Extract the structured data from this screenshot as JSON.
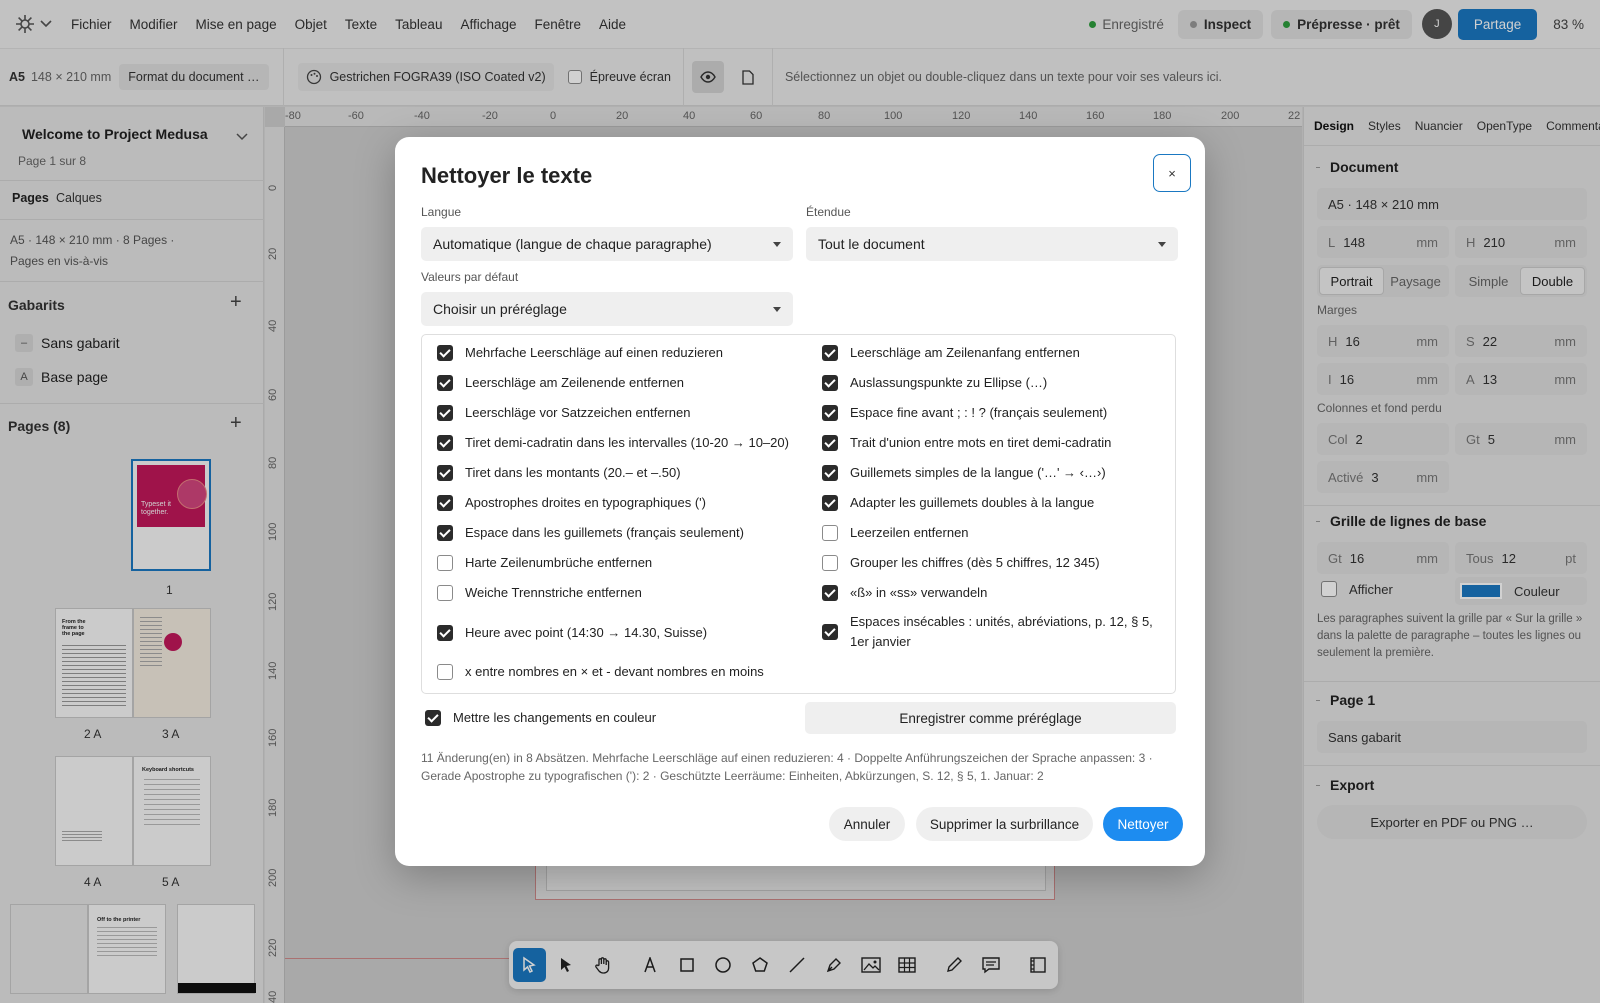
{
  "menubar": {
    "items": [
      "Fichier",
      "Modifier",
      "Mise en page",
      "Objet",
      "Texte",
      "Tableau",
      "Affichage",
      "Fenêtre",
      "Aide"
    ],
    "saved_status": "Enregistré",
    "inspect_label": "Inspect",
    "prepress_label": "Prépresse · prêt",
    "avatar_initial": "J",
    "share_label": "Partage",
    "zoom": "83 %"
  },
  "toolbar": {
    "format_badge": "A5",
    "format_size": "148 × 210 mm",
    "doc_format_button": "Format du document …",
    "color_profile": "Gestrichen FOGRA39 (ISO Coated v2)",
    "proof_label": "Épreuve écran",
    "hint": "Sélectionnez un objet ou double-cliquez dans un texte pour voir ses valeurs ici."
  },
  "left": {
    "project_title": "Welcome to Project Medusa",
    "page_info": "Page 1 sur 8",
    "tabs": [
      "Pages",
      "Calques"
    ],
    "doc_info_1": "A5 · 148 × 210 mm · 8 Pages ·",
    "doc_info_2": "Pages en vis-à-vis",
    "masters_title": "Gabarits",
    "masters": [
      {
        "badge": "–",
        "label": "Sans gabarit"
      },
      {
        "badge": "A",
        "label": "Base page"
      }
    ],
    "pages_title": "Pages (8)",
    "page_labels": [
      "1",
      "2 A",
      "3 A",
      "4 A",
      "5 A"
    ],
    "thumb1_text": "Typeset it together.",
    "thumb2_text": "From the frame to the page",
    "thumb5_text": "Keyboard shortcuts",
    "thumb7_text": "Off to the printer"
  },
  "ruler": {
    "top": [
      "-80",
      "-60",
      "-40",
      "-20",
      "0",
      "20",
      "40",
      "60",
      "80",
      "100",
      "120",
      "140",
      "160",
      "180",
      "200",
      "22"
    ],
    "left": [
      "0",
      "20",
      "40",
      "60",
      "80",
      "100",
      "120",
      "140",
      "160",
      "180",
      "200",
      "220",
      "40"
    ]
  },
  "dialog": {
    "title": "Nettoyer le texte",
    "close_label": "×",
    "language_label": "Langue",
    "language_value": "Automatique (langue de chaque paragraphe)",
    "scope_label": "Étendue",
    "scope_value": "Tout le document",
    "defaults_label": "Valeurs par défaut",
    "defaults_value": "Choisir un préréglage",
    "options_left": [
      {
        "label": "Mehrfache Leerschläge auf einen reduzieren",
        "checked": true
      },
      {
        "label": "Leerschläge am Zeilenende entfernen",
        "checked": true
      },
      {
        "label": "Leerschläge vor Satzzeichen entfernen",
        "checked": true
      },
      {
        "label": "Tiret demi-cadratin dans les intervalles (10-20 → 10–20)",
        "checked": true
      },
      {
        "label": "Tiret dans les montants (20.– et –.50)",
        "checked": true
      },
      {
        "label": "Apostrophes droites en typographiques (')",
        "checked": true
      },
      {
        "label": "Espace dans les guillemets (français seulement)",
        "checked": true
      },
      {
        "label": "Harte Zeilenumbrüche entfernen",
        "checked": false
      },
      {
        "label": "Weiche Trennstriche entfernen",
        "checked": false
      },
      {
        "label": "Heure avec point (14:30 → 14.30, Suisse)",
        "checked": true
      },
      {
        "label": "x entre nombres en × et - devant nombres en moins",
        "checked": false
      }
    ],
    "options_right": [
      {
        "label": "Leerschläge am Zeilenanfang entfernen",
        "checked": true
      },
      {
        "label": "Auslassungspunkte zu Ellipse (…)",
        "checked": true
      },
      {
        "label": "Espace fine avant ; : ! ? (français seulement)",
        "checked": true
      },
      {
        "label": "Trait d'union entre mots en tiret demi-cadratin",
        "checked": true
      },
      {
        "label": "Guillemets simples de la langue ('…' → ‹…›)",
        "checked": true
      },
      {
        "label": "Adapter les guillemets doubles à la langue",
        "checked": true
      },
      {
        "label": "Leerzeilen entfernen",
        "checked": false
      },
      {
        "label": "Grouper les chiffres (dès 5 chiffres, 12 345)",
        "checked": false
      },
      {
        "label": "«ß» in «ss» verwandeln",
        "checked": true
      },
      {
        "label": "Espaces insécables : unités, abréviations, p. 12, § 5, 1er janvier",
        "checked": true
      }
    ],
    "highlight_label": "Mettre les changements en couleur",
    "highlight_checked": true,
    "save_preset_label": "Enregistrer comme préréglage",
    "summary": "11 Änderung(en) in 8 Absätzen. Mehrfache Leerschläge auf einen reduzieren: 4 · Doppelte Anführungszeichen der Sprache anpassen: 3 · Gerade Apostrophe zu typografischen ('): 2 · Geschützte Leerräume: Einheiten, Abkürzungen, S. 12, § 5, 1. Januar: 2",
    "cancel_label": "Annuler",
    "remove_highlight_label": "Supprimer la surbrillance",
    "clean_label": "Nettoyer"
  },
  "right": {
    "tabs": [
      "Design",
      "Styles",
      "Nuancier",
      "OpenType",
      "Commentai"
    ],
    "document_title": "Document",
    "format_value": "A5 · 148 × 210 mm",
    "width": {
      "key": "L",
      "value": "148",
      "unit": "mm"
    },
    "height": {
      "key": "H",
      "value": "210",
      "unit": "mm"
    },
    "orientation": [
      "Portrait",
      "Paysage"
    ],
    "pages_mode": [
      "Simple",
      "Double"
    ],
    "margins_title": "Marges",
    "margin_top": {
      "key": "H",
      "value": "16",
      "unit": "mm"
    },
    "margin_right": {
      "key": "S",
      "value": "22",
      "unit": "mm"
    },
    "margin_inner": {
      "key": "I",
      "value": "16",
      "unit": "mm"
    },
    "margin_outer": {
      "key": "A",
      "value": "13",
      "unit": "mm"
    },
    "columns_title": "Colonnes et fond perdu",
    "columns": {
      "key": "Col",
      "value": "2"
    },
    "gutter": {
      "key": "Gt",
      "value": "5",
      "unit": "mm"
    },
    "bleed": {
      "key": "Activé",
      "value": "3",
      "unit": "mm"
    },
    "baseline_title": "Grille de lignes de base",
    "baseline_gt": {
      "key": "Gt",
      "value": "16",
      "unit": "mm"
    },
    "baseline_all": {
      "key": "Tous",
      "value": "12",
      "unit": "pt"
    },
    "show_label": "Afficher",
    "color_label": "Couleur",
    "baseline_color": "#1a78c2",
    "baseline_note": "Les paragraphes suivent la grille par « Sur la grille » dans la palette de paragraphe – toutes les lignes ou seulement la première.",
    "page_title": "Page 1",
    "page_master": "Sans gabarit",
    "export_title": "Export",
    "export_button": "Exporter en PDF ou PNG …"
  },
  "colors": {
    "accent": "#1a78c2",
    "primary_button": "#1d8cf0",
    "saved_dot": "#2e9e3e",
    "thumb_red": "#c2185b"
  }
}
